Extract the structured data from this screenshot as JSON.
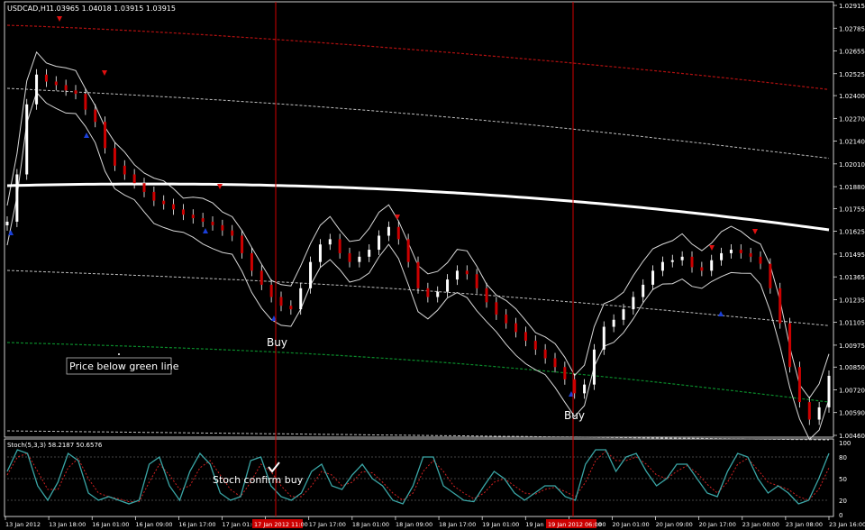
{
  "main": {
    "symbol_title": "USDCAD,H1",
    "ohlc": "1.03965 1.04018 1.03915 1.03915",
    "price_ticks": [
      "1.02915",
      "1.02785",
      "1.02655",
      "1.02525",
      "1.02400",
      "1.02270",
      "1.02140",
      "1.02010",
      "1.01880",
      "1.01755",
      "1.01625",
      "1.01495",
      "1.01365",
      "1.01235",
      "1.01105",
      "1.00975",
      "1.00850",
      "1.00720",
      "1.00590",
      "1.00460"
    ],
    "annotations": {
      "buy1": "Buy",
      "buy2": "Buy",
      "price_below": "Price below green line"
    }
  },
  "sub": {
    "title": "Stoch(5,3,3) 58.2187 50.6576",
    "level_ticks": [
      "100",
      "80",
      "50",
      "20",
      "0"
    ],
    "annotation": "Stoch confirm buy"
  },
  "time_labels": [
    "13 Jan 2012",
    "13 Jan 18:00",
    "16 Jan 01:00",
    "16 Jan 09:00",
    "16 Jan 17:00",
    "17 Jan 01:00",
    "17 Jan 17:00",
    "17 Jan 17:00",
    "18 Jan 01:00",
    "18 Jan 09:00",
    "18 Jan 17:00",
    "19 Jan 01:00",
    "19 Jan 09:00",
    "19 Jan 17:00",
    "20 Jan 01:00",
    "20 Jan 09:00",
    "20 Jan 17:00",
    "23 Jan 00:00",
    "23 Jan 08:00",
    "23 Jan 16:00"
  ],
  "highlighted_time_labels": [
    "17 Jan 2012 11:00",
    "19 Jan 2012 06:00"
  ],
  "colors": {
    "background": "#000000",
    "bull_candle": "#ffffff",
    "bear_candle": "#cc0000",
    "ma_line": "#ffffff",
    "channel_upper_outer": "#b01010",
    "channel_lower_outer": "#0a8a2a",
    "channel_inner": "#bfbfbf",
    "envelope": "#d8d8d8",
    "signal_vline": "#d00000",
    "stoch_main": "#3aa6a6",
    "stoch_signal": "#d02020",
    "up_arrow": "#1a3fd8",
    "down_arrow": "#e01010"
  },
  "chart_data": {
    "type": "candlestick",
    "symbol": "USDCAD,H1",
    "ylim": [
      1.0046,
      1.02915
    ],
    "close_series": [
      1.0168,
      1.0195,
      1.0235,
      1.0252,
      1.0248,
      1.0246,
      1.0243,
      1.0241,
      1.0232,
      1.0225,
      1.021,
      1.02,
      1.0195,
      1.019,
      1.0185,
      1.018,
      1.0178,
      1.0175,
      1.0172,
      1.017,
      1.0168,
      1.0166,
      1.0163,
      1.016,
      1.015,
      1.014,
      1.0132,
      1.0125,
      1.012,
      1.0118,
      1.013,
      1.0145,
      1.0155,
      1.0158,
      1.015,
      1.0145,
      1.0148,
      1.0152,
      1.016,
      1.0165,
      1.0158,
      1.0145,
      1.013,
      1.0125,
      1.0128,
      1.0135,
      1.014,
      1.0138,
      1.013,
      1.0122,
      1.0115,
      1.011,
      1.0105,
      1.01,
      1.0095,
      1.009,
      1.0085,
      1.0078,
      1.007,
      1.0075,
      1.0095,
      1.0108,
      1.0112,
      1.0118,
      1.0125,
      1.0132,
      1.014,
      1.0145,
      1.0146,
      1.0148,
      1.0142,
      1.014,
      1.0146,
      1.015,
      1.0152,
      1.015,
      1.0148,
      1.0144,
      1.013,
      1.011,
      1.0085,
      1.0065,
      1.0055,
      1.0062,
      1.008
    ],
    "stoch_main": [
      60,
      90,
      85,
      40,
      20,
      45,
      85,
      75,
      30,
      20,
      25,
      20,
      15,
      20,
      70,
      80,
      40,
      20,
      60,
      85,
      70,
      30,
      20,
      25,
      75,
      80,
      40,
      25,
      20,
      30,
      60,
      70,
      40,
      35,
      55,
      70,
      50,
      40,
      20,
      15,
      40,
      80,
      80,
      40,
      30,
      20,
      18,
      40,
      60,
      50,
      30,
      20,
      30,
      40,
      40,
      25,
      20,
      70,
      90,
      90,
      60,
      80,
      85,
      60,
      40,
      50,
      70,
      70,
      50,
      30,
      25,
      60,
      85,
      80,
      50,
      30,
      40,
      30,
      15,
      20,
      50,
      85
    ],
    "stoch_signal": [
      55,
      80,
      85,
      60,
      35,
      35,
      65,
      78,
      50,
      30,
      25,
      22,
      18,
      18,
      45,
      70,
      55,
      35,
      40,
      65,
      75,
      55,
      35,
      25,
      45,
      70,
      60,
      40,
      25,
      25,
      40,
      60,
      55,
      40,
      45,
      60,
      58,
      45,
      30,
      20,
      30,
      60,
      75,
      60,
      40,
      30,
      22,
      30,
      45,
      50,
      40,
      30,
      28,
      35,
      38,
      32,
      25,
      45,
      75,
      88,
      75,
      75,
      80,
      70,
      55,
      50,
      60,
      68,
      58,
      42,
      30,
      45,
      70,
      78,
      62,
      45,
      40,
      35,
      25,
      20,
      35,
      65
    ],
    "stoch_levels": [
      20,
      50,
      80
    ],
    "signals": [
      {
        "label": "Buy",
        "time": "17 Jan 2012 11:00"
      },
      {
        "label": "Buy",
        "time": "19 Jan 2012 06:00"
      }
    ]
  }
}
